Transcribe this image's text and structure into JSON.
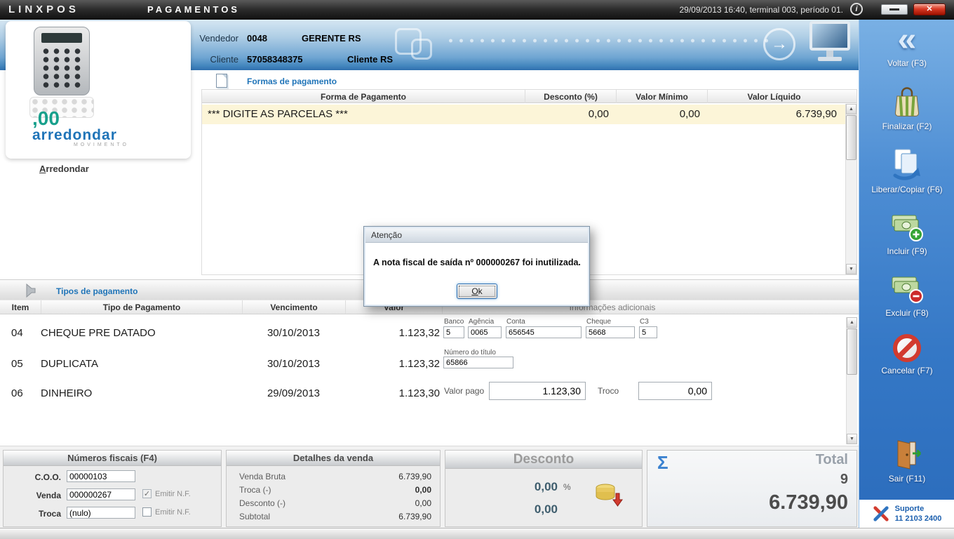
{
  "colors": {
    "accent_blue": "#1f74b8",
    "header_blue_bottom": "#2f6fae",
    "sidebar_blue": "#3578c6",
    "highlight_row": "#fcf5d8",
    "cancel_red": "#d23b2f"
  },
  "icons": {
    "up": "▲",
    "down": "▼",
    "check": "✓",
    "close": "✕",
    "info": "i",
    "back": "«",
    "sigma": "Σ",
    "arrow_right": "→"
  },
  "titlebar": {
    "logo": "LINXPOS",
    "title": "PAGAMENTOS",
    "status": "29/09/2013 16:40, terminal 003, período 01."
  },
  "header": {
    "vendedor_label": "Vendedor",
    "vendedor_code": "0048",
    "vendedor_name": "GERENTE RS",
    "cliente_label": "Cliente",
    "cliente_code": "57058348375",
    "cliente_name": "Cliente RS"
  },
  "left_panel": {
    "logo_mark": ",00",
    "logo_word": "arredondar",
    "logo_sub": "MOVIMENTO",
    "link_label": "Arredondar"
  },
  "formas": {
    "title": "Formas de pagamento",
    "columns": [
      "Forma de Pagamento",
      "Desconto (%)",
      "Valor Mínimo",
      "Valor Líquido"
    ],
    "row": {
      "forma": "*** DIGITE AS PARCELAS ***",
      "desconto": "0,00",
      "valor_minimo": "0,00",
      "valor_liquido": "6.739,90"
    }
  },
  "dialog": {
    "title": "Atenção",
    "message": "A nota fiscal de saída nº 000000267 foi inutilizada.",
    "ok_label": "Ok"
  },
  "tipos": {
    "title": "Tipos de pagamento",
    "columns": [
      "Item",
      "Tipo de Pagamento",
      "Vencimento",
      "Valor",
      "Informações adicionais"
    ],
    "rows": [
      {
        "item": "04",
        "tipo": "CHEQUE PRE DATADO",
        "vencimento": "30/10/2013",
        "valor": "1.123,32",
        "banco_label": "Banco",
        "banco": "5",
        "agencia_label": "Agência",
        "agencia": "0065",
        "conta_label": "Conta",
        "conta": "656545",
        "cheque_label": "Cheque",
        "cheque": "5668",
        "c3_label": "C3",
        "c3": "5"
      },
      {
        "item": "05",
        "tipo": "DUPLICATA",
        "vencimento": "30/10/2013",
        "valor": "1.123,32",
        "titulo_label": "Número do título",
        "titulo": "65866"
      },
      {
        "item": "06",
        "tipo": "DINHEIRO",
        "vencimento": "29/09/2013",
        "valor": "1.123,30",
        "valor_pago_label": "Valor pago",
        "valor_pago": "1.123,30",
        "troco_label": "Troco",
        "troco": "0,00"
      }
    ]
  },
  "numeros_fiscais": {
    "title": "Números fiscais (F4)",
    "coo_label": "C.O.O.",
    "coo": "00000103",
    "venda_label": "Venda",
    "venda": "000000267",
    "venda_nf_label": "Emitir N.F.",
    "troca_label": "Troca",
    "troca": "(nulo)",
    "troca_nf_label": "Emitir N.F."
  },
  "detalhes": {
    "title": "Detalhes da venda",
    "rows": [
      {
        "label": "Venda Bruta",
        "value": "6.739,90"
      },
      {
        "label": "Troca (-)",
        "value": "0,00"
      },
      {
        "label": "Desconto (-)",
        "value": "0,00"
      },
      {
        "label": "Subtotal",
        "value": "6.739,90"
      }
    ]
  },
  "desconto": {
    "title": "Desconto",
    "percent": "0,00",
    "percent_symbol": "%",
    "value": "0,00"
  },
  "total": {
    "title": "Total",
    "count": "9",
    "value": "6.739,90"
  },
  "sidebar": {
    "buttons": [
      {
        "label": "Voltar (F3)"
      },
      {
        "label": "Finalizar (F2)"
      },
      {
        "label": "Liberar/Copiar (F6)"
      },
      {
        "label": "Incluir (F9)"
      },
      {
        "label": "Excluir (F8)"
      },
      {
        "label": "Cancelar (F7)"
      },
      {
        "label": "Sair (F11)"
      }
    ],
    "support_title": "Suporte",
    "support_phone": "11 2103 2400"
  }
}
